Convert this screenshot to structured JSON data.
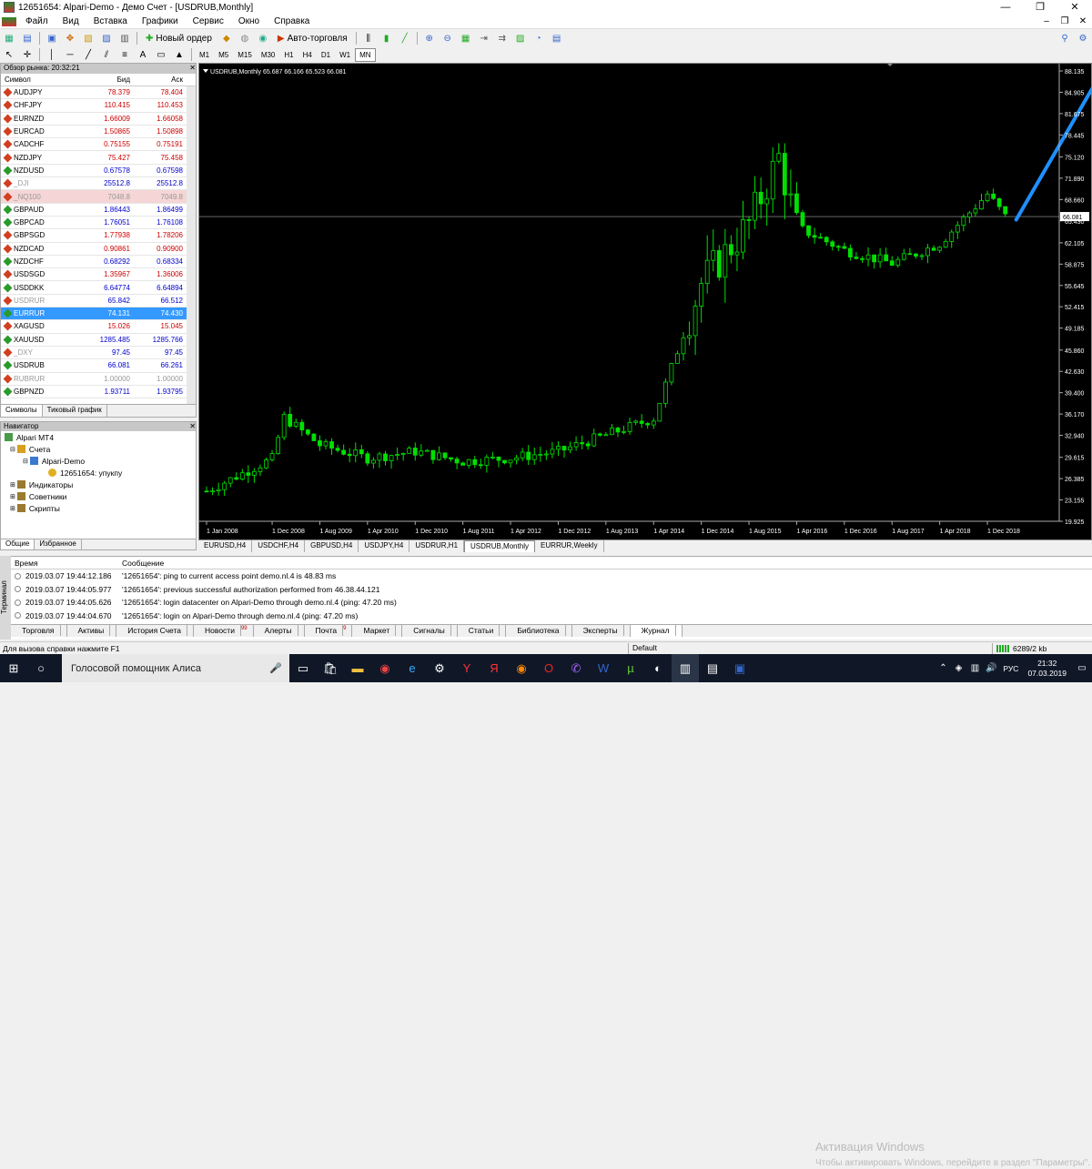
{
  "window": {
    "title": "12651654: Alpari-Demo - Демо Счет - [USDRUB,Monthly]"
  },
  "menu": [
    "Файл",
    "Вид",
    "Вставка",
    "Графики",
    "Сервис",
    "Окно",
    "Справка"
  ],
  "toolbar": {
    "new_order": "Новый ордер",
    "auto_trading": "Авто-торговля"
  },
  "timeframes": [
    "M1",
    "M5",
    "M15",
    "M30",
    "H1",
    "H4",
    "D1",
    "W1",
    "MN"
  ],
  "active_timeframe": "MN",
  "market_watch": {
    "title": "Обзор рынка: 20:32:21",
    "col_symbol": "Символ",
    "col_bid": "Бид",
    "col_ask": "Аск",
    "rows": [
      {
        "s": "AUDJPY",
        "b": "78.379",
        "a": "78.404",
        "k": "red"
      },
      {
        "s": "CHFJPY",
        "b": "110.415",
        "a": "110.453",
        "k": "red"
      },
      {
        "s": "EURNZD",
        "b": "1.66009",
        "a": "1.66058",
        "k": "red"
      },
      {
        "s": "EURCAD",
        "b": "1.50865",
        "a": "1.50898",
        "k": "red"
      },
      {
        "s": "CADCHF",
        "b": "0.75155",
        "a": "0.75191",
        "k": "red"
      },
      {
        "s": "NZDJPY",
        "b": "75.427",
        "a": "75.458",
        "k": "red"
      },
      {
        "s": "NZDUSD",
        "b": "0.67578",
        "a": "0.67598",
        "k": "blue"
      },
      {
        "s": "_DJI",
        "b": "25512.8",
        "a": "25512.8",
        "k": "greyblue"
      },
      {
        "s": "_NQ100",
        "b": "7048.8",
        "a": "7049.8",
        "k": "pink"
      },
      {
        "s": "GBPAUD",
        "b": "1.86443",
        "a": "1.86499",
        "k": "blue"
      },
      {
        "s": "GBPCAD",
        "b": "1.76051",
        "a": "1.76108",
        "k": "blue"
      },
      {
        "s": "GBPSGD",
        "b": "1.77938",
        "a": "1.78206",
        "k": "red"
      },
      {
        "s": "NZDCAD",
        "b": "0.90861",
        "a": "0.90900",
        "k": "red"
      },
      {
        "s": "NZDCHF",
        "b": "0.68292",
        "a": "0.68334",
        "k": "blue"
      },
      {
        "s": "USDSGD",
        "b": "1.35967",
        "a": "1.36006",
        "k": "red"
      },
      {
        "s": "USDDKK",
        "b": "6.64774",
        "a": "6.64894",
        "k": "blue"
      },
      {
        "s": "USDRUR",
        "b": "65.842",
        "a": "66.512",
        "k": "greyblue"
      },
      {
        "s": "EURRUR",
        "b": "74.131",
        "a": "74.430",
        "k": "sel"
      },
      {
        "s": "XAGUSD",
        "b": "15.026",
        "a": "15.045",
        "k": "red"
      },
      {
        "s": "XAUUSD",
        "b": "1285.485",
        "a": "1285.766",
        "k": "blue"
      },
      {
        "s": "_DXY",
        "b": "97.45",
        "a": "97.45",
        "k": "greyblue"
      },
      {
        "s": "USDRUB",
        "b": "66.081",
        "a": "66.261",
        "k": "blue"
      },
      {
        "s": "RUBRUR",
        "b": "1.00000",
        "a": "1.00000",
        "k": "grey"
      },
      {
        "s": "GBPNZD",
        "b": "1.93711",
        "a": "1.93795",
        "k": "blue"
      }
    ],
    "tabs": [
      "Символы",
      "Тиковый график"
    ]
  },
  "navigator": {
    "title": "Навигатор",
    "items": [
      "Alpari MT4",
      "Счета",
      "Alpari-Demo",
      "12651654: упукпу",
      "Индикаторы",
      "Советники",
      "Скрипты"
    ],
    "tabs": [
      "Общие",
      "Избранное"
    ]
  },
  "chart": {
    "header": "USDRUB,Monthly  65.687 66.166 65.523 66.081",
    "price_label": "66.081",
    "y_ticks": [
      "88.135",
      "84.905",
      "81.675",
      "78.445",
      "75.120",
      "71.890",
      "68.660",
      "65.430",
      "62.105",
      "58.875",
      "55.645",
      "52.415",
      "49.185",
      "45.860",
      "42.630",
      "39.400",
      "36.170",
      "32.940",
      "29.615",
      "26.385",
      "23.155",
      "19.925"
    ],
    "x_ticks": [
      "1 Jan 2008",
      "1 Dec 2008",
      "1 Aug 2009",
      "1 Apr 2010",
      "1 Dec 2010",
      "1 Aug 2011",
      "1 Apr 2012",
      "1 Dec 2012",
      "1 Aug 2013",
      "1 Apr 2014",
      "1 Dec 2014",
      "1 Aug 2015",
      "1 Apr 2016",
      "1 Dec 2016",
      "1 Aug 2017",
      "1 Apr 2018",
      "1 Dec 2018"
    ],
    "colors": {
      "bull": "#00e000",
      "bear": "#00e000",
      "trendline": "#1e90ff",
      "grid": "#404040"
    }
  },
  "chart_tabs": [
    "EURUSD,H4",
    "USDCHF,H4",
    "GBPUSD,H4",
    "USDJPY,H4",
    "USDRUR,H1",
    "USDRUB,Monthly",
    "EURRUR,Weekly"
  ],
  "terminal": {
    "col_time": "Время",
    "col_msg": "Сообщение",
    "rows": [
      {
        "t": "2019.03.07 19:44:12.186",
        "m": "'12651654': ping to current access point demo.nl.4 is 48.83 ms"
      },
      {
        "t": "2019.03.07 19:44:05.977",
        "m": "'12651654': previous successful authorization performed from 46.38.44.121"
      },
      {
        "t": "2019.03.07 19:44:05.626",
        "m": "'12651654': login datacenter on Alpari-Demo through demo.nl.4 (ping: 47.20 ms)"
      },
      {
        "t": "2019.03.07 19:44:04.670",
        "m": "'12651654': login on Alpari-Demo through demo.nl.4 (ping: 47.20 ms)"
      }
    ],
    "side_label": "Терминал",
    "tabs": [
      {
        "l": "Торговля",
        "n": ""
      },
      {
        "l": "Активы",
        "n": ""
      },
      {
        "l": "История Счета",
        "n": ""
      },
      {
        "l": "Новости",
        "n": "99"
      },
      {
        "l": "Алерты",
        "n": ""
      },
      {
        "l": "Почта",
        "n": "9"
      },
      {
        "l": "Маркет",
        "n": ""
      },
      {
        "l": "Сигналы",
        "n": ""
      },
      {
        "l": "Статьи",
        "n": ""
      },
      {
        "l": "Библиотека",
        "n": ""
      },
      {
        "l": "Эксперты",
        "n": ""
      },
      {
        "l": "Журнал",
        "n": ""
      }
    ],
    "active_tab": "Журнал"
  },
  "watermark": {
    "title": "Активация Windows",
    "text": "Чтобы активировать Windows, перейдите в раздел \"Параметры\"."
  },
  "status": {
    "help": "Для вызова справки нажмите F1",
    "profile": "Default",
    "traffic": "6289/2 kb"
  },
  "taskbar": {
    "search": "Голосовой помощник Алиса",
    "lang": "РУС",
    "time": "21:32",
    "date": "07.03.2019"
  },
  "chart_data": {
    "type": "candlestick",
    "symbol": "USDRUB",
    "timeframe": "Monthly",
    "ylim": [
      19.925,
      88.135
    ],
    "approx_closes": [
      {
        "d": "2008-01",
        "c": 24.5
      },
      {
        "d": "2008-12",
        "c": 29.4
      },
      {
        "d": "2009-02",
        "c": 35.7
      },
      {
        "d": "2009-08",
        "c": 31.5
      },
      {
        "d": "2010-04",
        "c": 29.5
      },
      {
        "d": "2010-12",
        "c": 30.5
      },
      {
        "d": "2011-08",
        "c": 29.0
      },
      {
        "d": "2012-04",
        "c": 29.5
      },
      {
        "d": "2012-12",
        "c": 30.5
      },
      {
        "d": "2013-08",
        "c": 33.0
      },
      {
        "d": "2014-04",
        "c": 35.5
      },
      {
        "d": "2014-12",
        "c": 56.0
      },
      {
        "d": "2015-08",
        "c": 65.0
      },
      {
        "d": "2016-01",
        "c": 75.0
      },
      {
        "d": "2016-04",
        "c": 64.5
      },
      {
        "d": "2016-12",
        "c": 61.0
      },
      {
        "d": "2017-08",
        "c": 59.0
      },
      {
        "d": "2018-04",
        "c": 62.0
      },
      {
        "d": "2018-12",
        "c": 69.5
      },
      {
        "d": "2019-03",
        "c": 66.081
      }
    ]
  }
}
